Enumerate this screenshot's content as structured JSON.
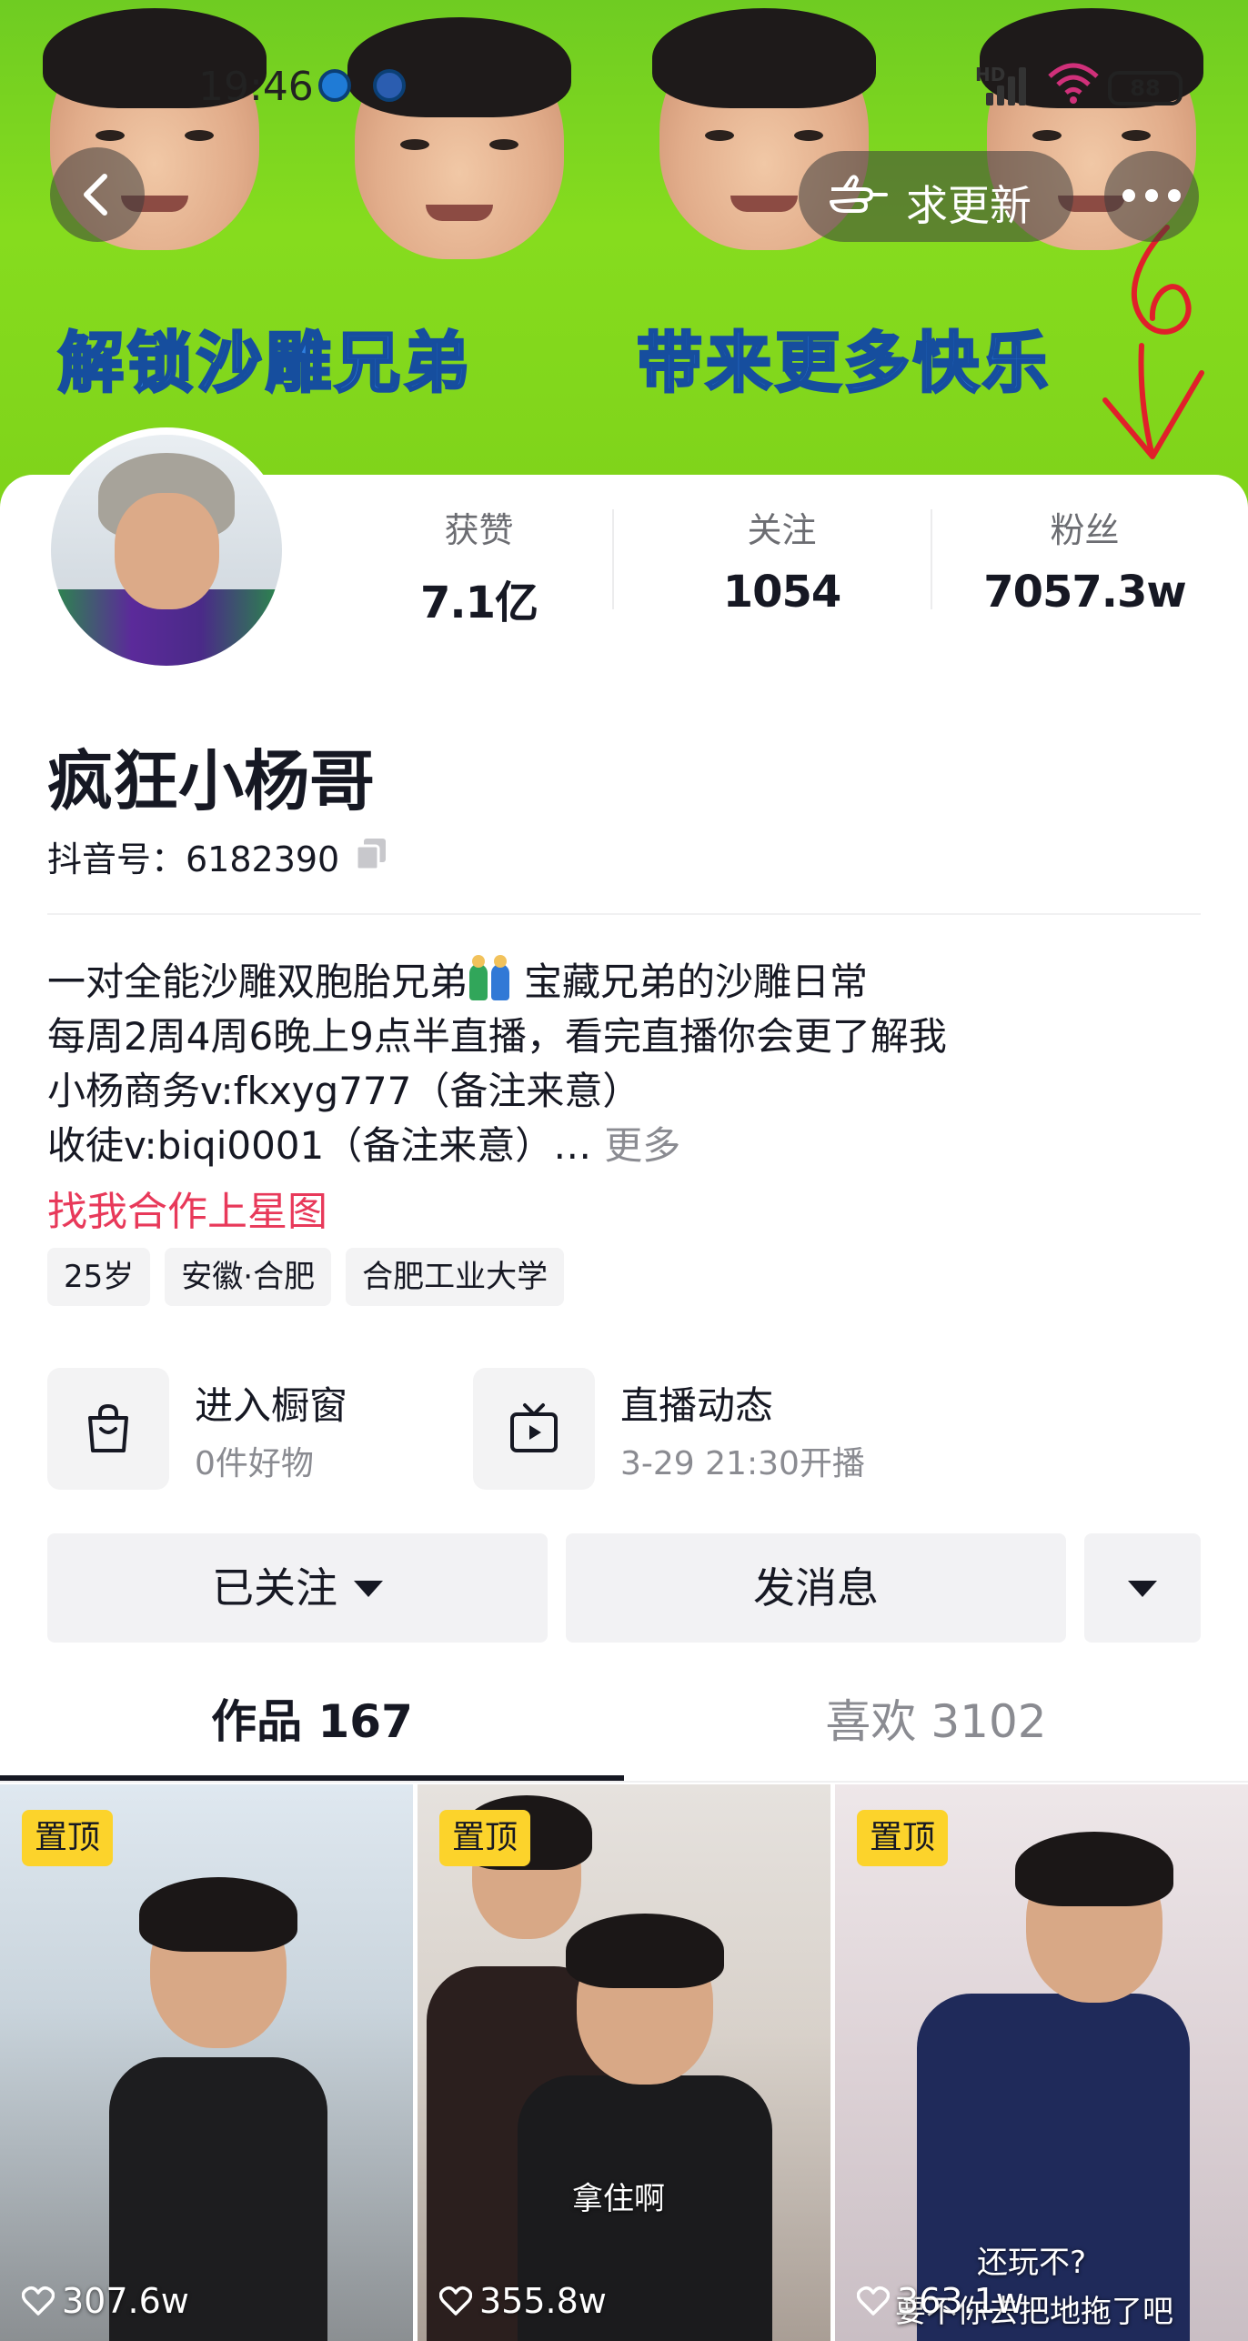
{
  "status_bar": {
    "time": "19:46",
    "hd": "HD",
    "battery": "88"
  },
  "banner": {
    "slogan_left": "解锁沙雕兄弟",
    "slogan_right": "带来更多快乐"
  },
  "nav": {
    "update_label": "求更新"
  },
  "profile": {
    "stats": [
      {
        "label": "获赞",
        "value": "7.1亿"
      },
      {
        "label": "关注",
        "value": "1054"
      },
      {
        "label": "粉丝",
        "value": "7057.3w"
      }
    ],
    "name": "疯狂小杨哥",
    "douyin_id": "抖音号：6182390",
    "bio": [
      "一对全能沙雕双胞胎兄弟",
      "宝藏兄弟的沙雕日常",
      "每周2周4周6晚上9点半直播，看完直播你会更了解我",
      "小杨商务v:fkxyg777（备注来意）",
      "收徒v:biqi0001（备注来意）…"
    ],
    "bio_more": "更多",
    "star_link": "找我合作上星图",
    "tags": [
      "25岁",
      "安徽·合肥",
      "合肥工业大学"
    ]
  },
  "entries": {
    "shop": {
      "title": "进入橱窗",
      "subtitle": "0件好物",
      "icon": "shopping-bag-icon"
    },
    "live": {
      "title": "直播动态",
      "subtitle": "3-29 21:30开播",
      "icon": "tv-icon"
    }
  },
  "actions": {
    "followed": "已关注",
    "message": "发消息"
  },
  "tabs": [
    {
      "label": "作品 167",
      "active": true
    },
    {
      "label": "喜欢 3102",
      "active": false
    }
  ],
  "videos": [
    {
      "pinned": "置顶",
      "likes": "307.6w",
      "caption": ""
    },
    {
      "pinned": "置顶",
      "likes": "355.8w",
      "caption": "拿住啊"
    },
    {
      "pinned": "置顶",
      "likes": "363.1w",
      "caption": "还玩不?",
      "caption2": "要不你去把地拖了吧"
    }
  ],
  "colors": {
    "banner_green": "#86dc1e",
    "accent_pink": "#e8395a",
    "pinned_yellow": "#fcd32b"
  }
}
